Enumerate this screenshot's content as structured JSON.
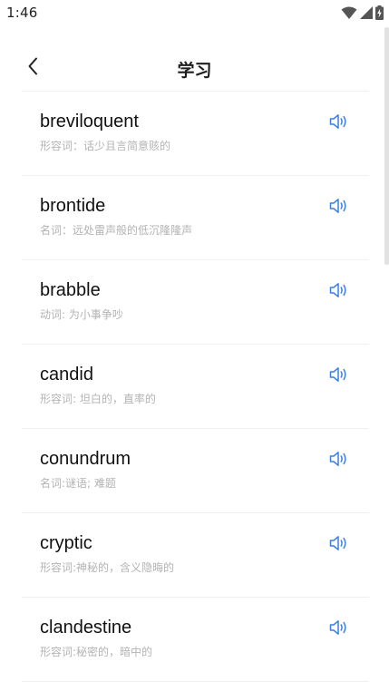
{
  "status_bar": {
    "time": "1:46",
    "icons": [
      "wifi-icon",
      "signal-icon",
      "battery-charging-icon"
    ]
  },
  "header": {
    "title": "学习",
    "back_icon": "chevron-left-icon"
  },
  "accent_color": "#3d7fe0",
  "words": [
    {
      "word": "breviloquent",
      "meaning": "形容词：话少且言简意赅的"
    },
    {
      "word": "brontide",
      "meaning": "名词：远处雷声般的低沉隆隆声"
    },
    {
      "word": "brabble",
      "meaning": "动词: 为小事争吵"
    },
    {
      "word": "candid",
      "meaning": "形容词: 坦白的，直率的"
    },
    {
      "word": "conundrum",
      "meaning": "名词:谜语; 难题"
    },
    {
      "word": "cryptic",
      "meaning": "形容词:神秘的，含义隐晦的"
    },
    {
      "word": "clandestine",
      "meaning": "形容词:秘密的，暗中的"
    }
  ]
}
